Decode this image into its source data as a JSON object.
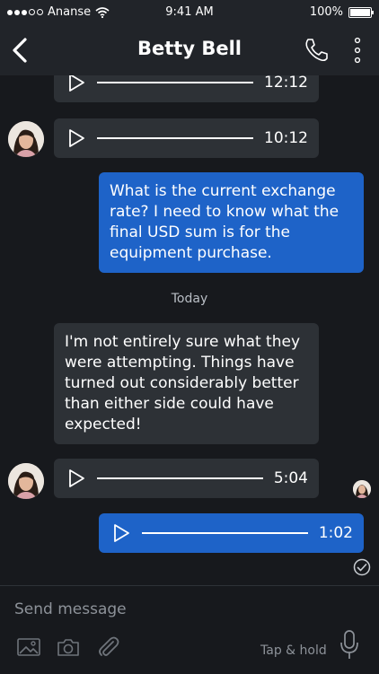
{
  "status_bar": {
    "carrier": "Ananse",
    "time": "9:41 AM",
    "battery": "100%"
  },
  "header": {
    "title": "Betty Bell",
    "back_icon": "chevron-left-icon",
    "call_icon": "phone-icon",
    "more_icon": "more-vertical-icon"
  },
  "messages": {
    "audio_1": {
      "duration": "12:12"
    },
    "audio_2": {
      "duration": "10:12"
    },
    "text_out_1": {
      "text": "What is the current exchange rate? I need to know what the final USD sum is for the equipment purchase."
    },
    "date_separator": "Today",
    "text_in_1": {
      "text": "I'm not entirely sure what they were attempting. Things have turned out considerably better than either side could have expected!"
    },
    "audio_3": {
      "duration": "5:04"
    },
    "audio_4": {
      "duration": "1:02"
    }
  },
  "composer": {
    "placeholder": "Send message",
    "hint": "Tap & hold",
    "icons": [
      "image-icon",
      "camera-icon",
      "paperclip-icon",
      "microphone-icon"
    ]
  },
  "colors": {
    "background": "#17191d",
    "incoming_bubble": "#2d3136",
    "outgoing_bubble": "#1e63c8",
    "header": "#212429"
  }
}
